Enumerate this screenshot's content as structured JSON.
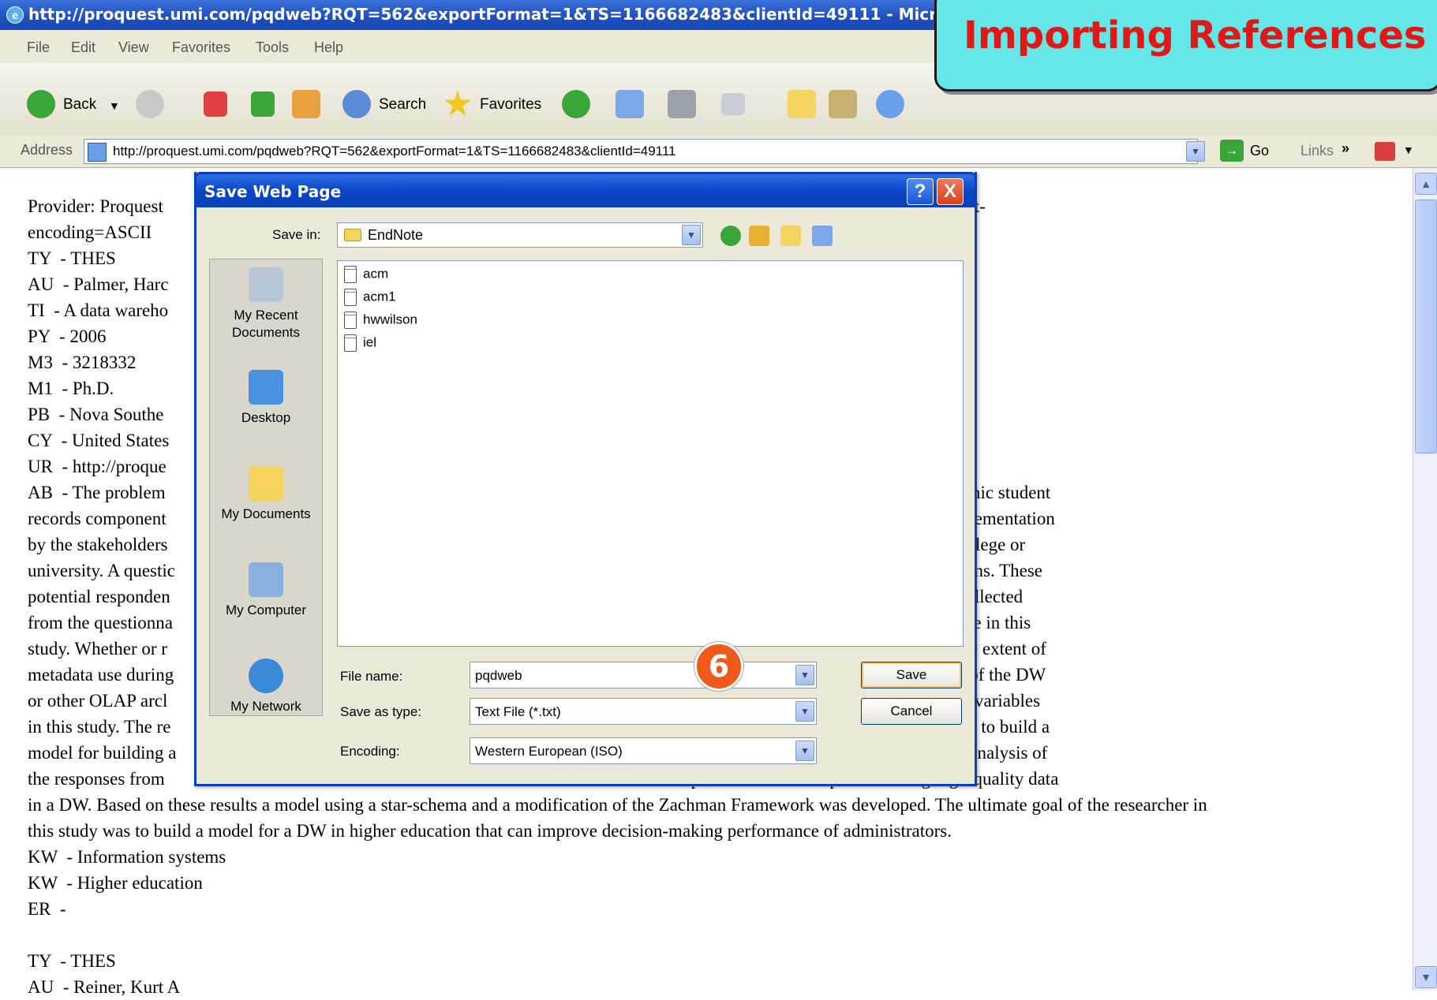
{
  "window": {
    "title": "http://proquest.umi.com/pqdweb?RQT=562&exportFormat=1&TS=1166682483&clientId=49111 - Microsoft Internet Explorer"
  },
  "menu": [
    "File",
    "Edit",
    "View",
    "Favorites",
    "Tools",
    "Help"
  ],
  "toolbar": {
    "back": "Back",
    "search": "Search",
    "favorites": "Favorites"
  },
  "address": {
    "label": "Address",
    "url": "http://proquest.umi.com/pqdweb?RQT=562&exportFormat=1&TS=1166682483&clientId=49111",
    "go": "Go",
    "links": "Links"
  },
  "callout": {
    "text": "Importing References"
  },
  "content": {
    "lines": [
      "Provider: Proquest                                                                                                               earning Company DBname=ProQuest Text-",
      "encoding=ASCII",
      "TY  - THES",
      "AU  - Palmer, Harc",
      "TI  - A data wareho",
      "PY  - 2006",
      "M3  - 3218332",
      "M1  - Ph.D.",
      "PB  - Nova Southe",
      "CY  - United States",
      "UR  - http://proque                                                                                                                        D",
      "AB  - The problem                                                                                                                           of the data contained in the academic student",
      "records component                                                                                                                   ata and be considered a successful implementation",
      "by the stakeholders                                                                                                                   le to make sound decisions for their college or",
      "university. A questic                                                                                                                  o worked in higher education institutions. These",
      "potential responden                                                                                                                   o access the questionnaire. The data collected",
      "from the questionna                                                                                                                  ality was used as the dependent variable in this",
      "study. Whether or r                                                                                                                   rocessing (OLAP) data architecture, the extent of",
      "metadata use during                                                                                                                   re developed before the development of the DW",
      "or other OLAP arcl                                                                                                                    architecture were used as independent variables",
      "in this study. The re                                                                                                                   tructs. These constructs were then used to build a",
      "model for building a                                                                                                                   ic student records applications. After analysis of",
      "the responses from                                                                                                                    positive relationship to obtaining high-quality data",
      "in a DW. Based on these results a model using a star-schema and a modification of the Zachman Framework was developed. The ultimate goal of the researcher in",
      "this study was to build a model for a DW in higher education that can improve decision-making performance of administrators.",
      "KW  - Information systems",
      "KW  - Higher education",
      "ER  -",
      "",
      "TY  - THES",
      "AU  - Reiner, Kurt A"
    ]
  },
  "dialog": {
    "title": "Save Web Page",
    "help": "?",
    "close": "X",
    "save_in_label": "Save in:",
    "save_in_value": "EndNote",
    "places": [
      "My Recent Documents",
      "Desktop",
      "My Documents",
      "My Computer",
      "My Network"
    ],
    "files": [
      "acm",
      "acm1",
      "hwwilson",
      "iel"
    ],
    "file_name_label": "File name:",
    "file_name_value": "pqdweb",
    "save_as_type_label": "Save as type:",
    "save_as_type_value": "Text File (*.txt)",
    "encoding_label": "Encoding:",
    "encoding_value": "Western European (ISO)",
    "save_button": "Save",
    "cancel_button": "Cancel"
  },
  "step_badge": "6"
}
